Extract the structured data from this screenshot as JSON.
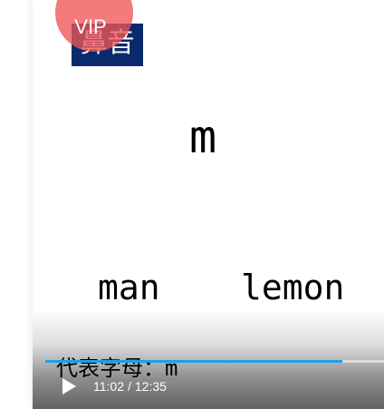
{
  "badge": {
    "text": "鼻音"
  },
  "lesson": {
    "letter": "m",
    "words": [
      "man",
      "lemon"
    ]
  },
  "subtitle": {
    "label": "代表字母：",
    "letter": "m"
  },
  "player": {
    "current_time": "11:02",
    "separator": "/",
    "duration": "12:35",
    "progress": 0.877,
    "progress_color": "#1ea0e6",
    "play_icon": "play-icon"
  },
  "vip": {
    "label": "VIP",
    "color": "#f05656"
  }
}
